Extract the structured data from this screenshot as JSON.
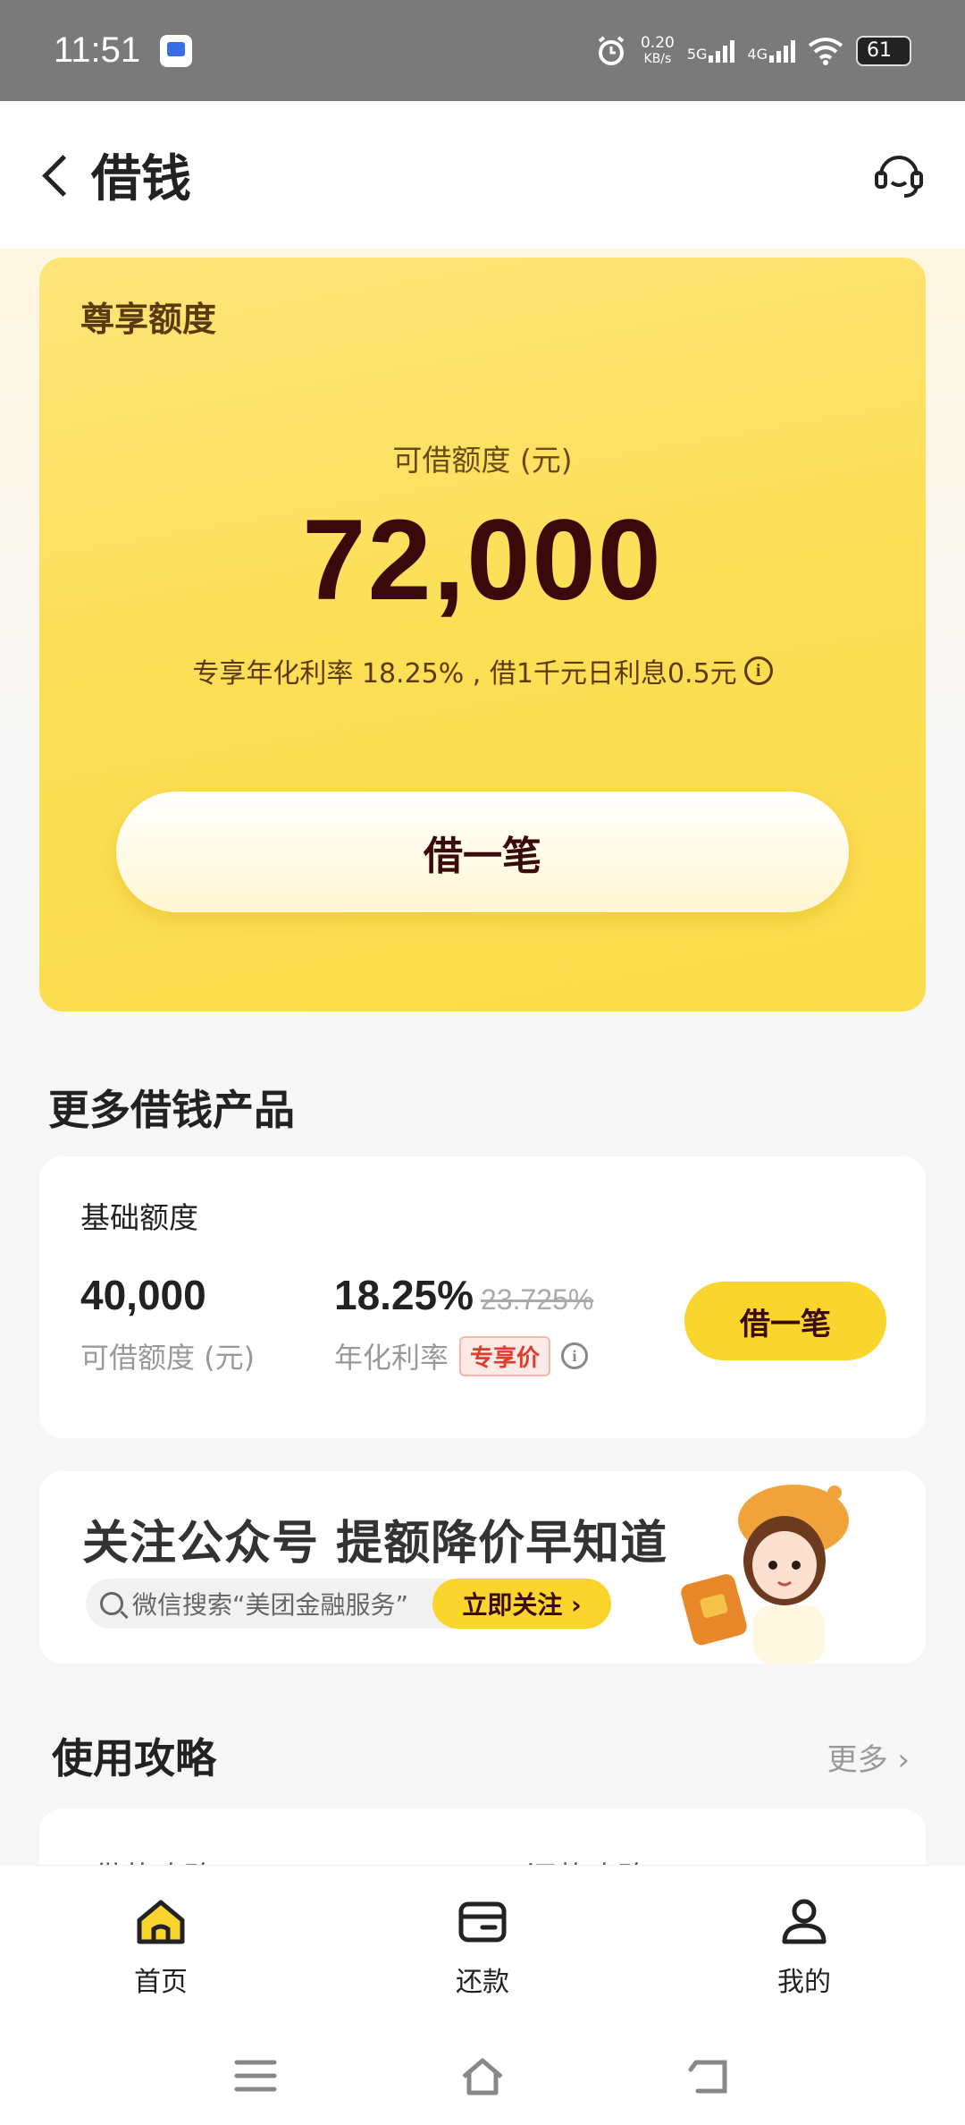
{
  "status_bar": {
    "time": "11:51",
    "net_speed_value": "0.20",
    "net_speed_unit": "KB/s",
    "signal1": "5G",
    "signal2": "4G",
    "battery": "61"
  },
  "header": {
    "title": "借钱"
  },
  "quota_card": {
    "tag": "尊享额度",
    "avail_label": "可借额度 (元)",
    "amount": "72,000",
    "rate_line": "专享年化利率 18.25% , 借1千元日利息0.5元",
    "borrow_button": "借一笔"
  },
  "more_section": {
    "title": "更多借钱产品"
  },
  "product": {
    "name": "基础额度",
    "amount": "40,000",
    "amount_label": "可借额度 (元)",
    "rate": "18.25%",
    "old_rate": "23.725%",
    "rate_label": "年化利率",
    "badge": "专享价",
    "button": "借一笔"
  },
  "banner": {
    "headline": "关注公众号 提额降价早知道",
    "search_text": "微信搜索“美团金融服务”",
    "follow_button": "立即关注 ›"
  },
  "guide": {
    "title": "使用攻略",
    "more": "更多 ›",
    "items": [
      "借款攻略",
      "还款攻略"
    ]
  },
  "tabbar": {
    "items": [
      {
        "label": "首页",
        "icon": "home-icon"
      },
      {
        "label": "还款",
        "icon": "wallet-icon"
      },
      {
        "label": "我的",
        "icon": "profile-icon"
      }
    ],
    "active_color": "#fad52e"
  },
  "colors": {
    "accent": "#fad52e",
    "card": "#fcdf55",
    "text_dark": "#3a0a0a"
  }
}
